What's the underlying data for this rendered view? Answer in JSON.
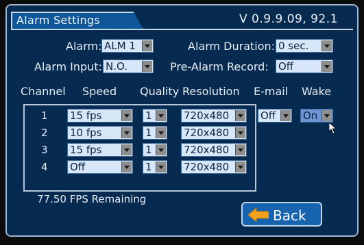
{
  "header": {
    "title": "Alarm Settings",
    "version": "V  0.9.9.09, 92.1"
  },
  "alarm": {
    "label": "Alarm:",
    "value": "ALM 1"
  },
  "alarm_duration": {
    "label": "Alarm  Duration:",
    "value": "0 sec."
  },
  "alarm_input": {
    "label": "Alarm  Input:",
    "value": "N.O."
  },
  "pre_alarm": {
    "label": "Pre-Alarm  Record:",
    "value": "Off"
  },
  "columns": {
    "channel": "Channel",
    "speed": "Speed",
    "quality": "Quality",
    "resolution": "Resolution",
    "email": "E-mail",
    "wake": "Wake"
  },
  "channels": [
    {
      "channel": "1",
      "speed": "15  fps",
      "quality": "1",
      "resolution": "720x480"
    },
    {
      "channel": "2",
      "speed": "10  fps",
      "quality": "1",
      "resolution": "720x480"
    },
    {
      "channel": "3",
      "speed": "15  fps",
      "quality": "1",
      "resolution": "720x480"
    },
    {
      "channel": "4",
      "speed": "Off",
      "quality": "1",
      "resolution": "720x480"
    }
  ],
  "email": {
    "value": "Off"
  },
  "wake": {
    "value": "On"
  },
  "fps_remaining": "77.50  FPS  Remaining",
  "back_button": {
    "label": "Back"
  },
  "colors": {
    "panel": "#062a50",
    "selected_field": "#6e95cf",
    "field": "#d8e7f7",
    "back_arrow": "#f2a21b"
  }
}
